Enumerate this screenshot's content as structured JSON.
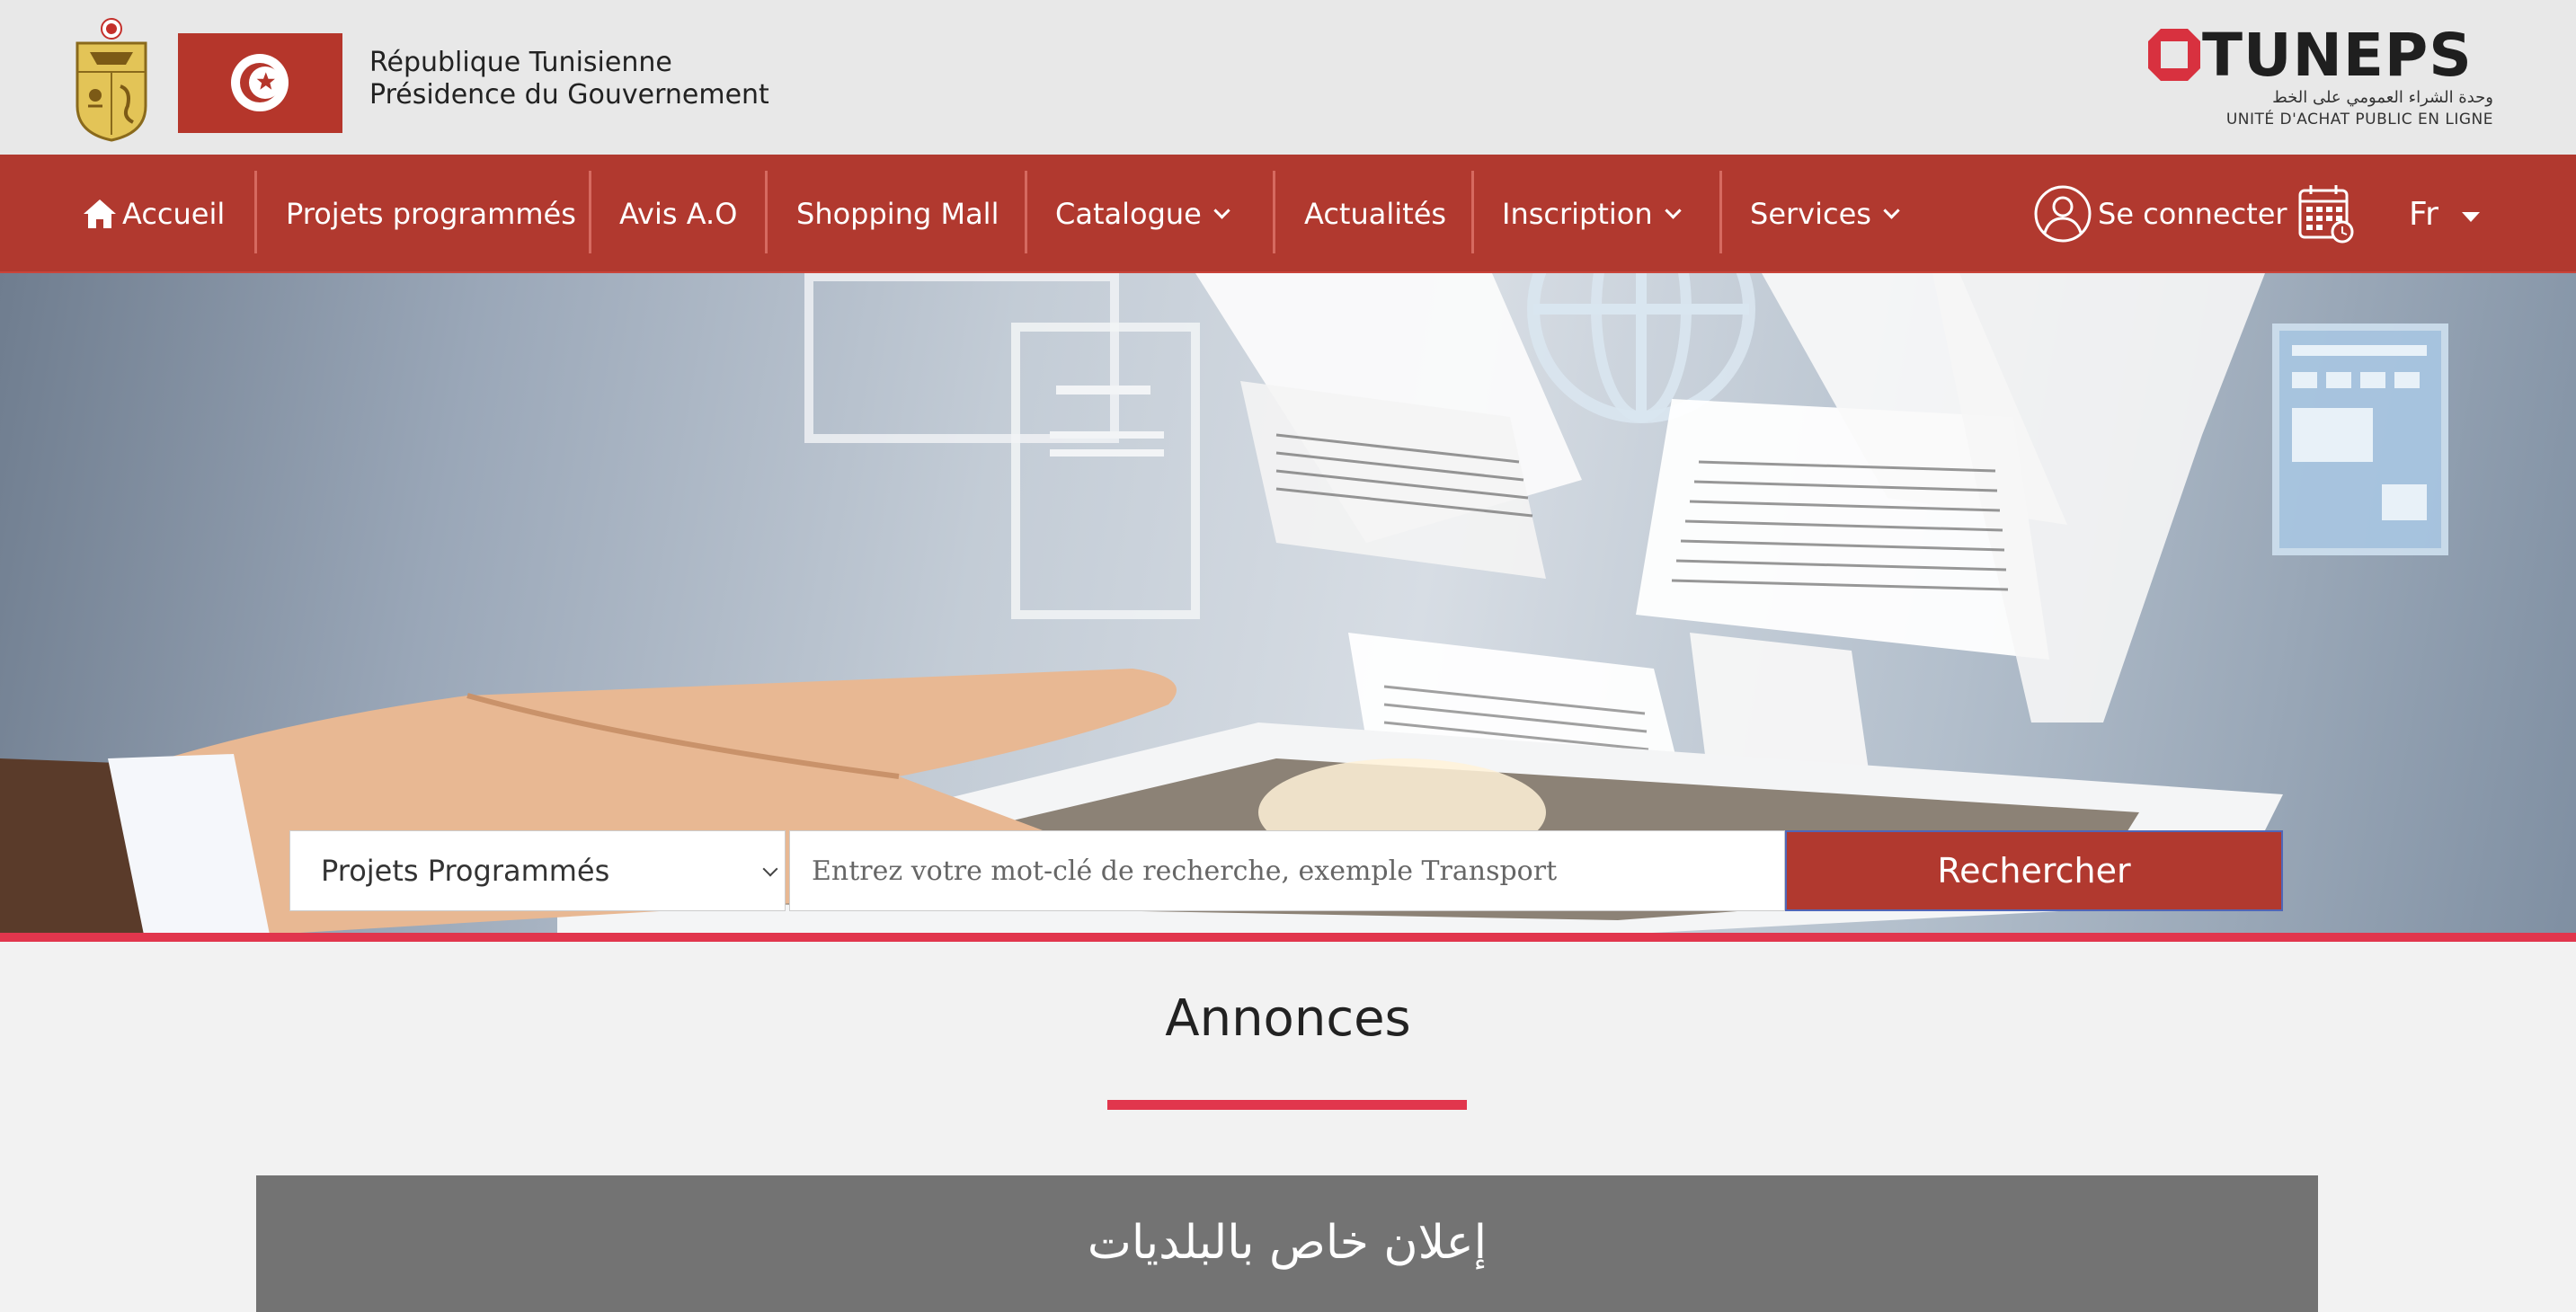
{
  "header": {
    "gov_line1": "République Tunisienne",
    "gov_line2": "Présidence du Gouvernement",
    "logo": {
      "name": "TUNEPS",
      "arabic": "وحدة الشراء العمومي على الخط",
      "subtitle": "UNITÉ D'ACHAT PUBLIC EN LIGNE"
    }
  },
  "nav": {
    "items": [
      {
        "label": "Accueil",
        "icon": "home-icon"
      },
      {
        "label": "Projets programmés"
      },
      {
        "label": "Avis A.O"
      },
      {
        "label": "Shopping Mall"
      },
      {
        "label": "Catalogue",
        "dropdown": true
      },
      {
        "label": "Actualités"
      },
      {
        "label": "Inscription",
        "dropdown": true
      },
      {
        "label": "Services",
        "dropdown": true
      }
    ],
    "login_label": "Se connecter",
    "language": "Fr"
  },
  "search": {
    "category_selected": "Projets Programmés",
    "placeholder": "Entrez votre mot-clé de recherche, exemple Transport",
    "button_label": "Rechercher"
  },
  "annonces": {
    "title": "Annonces",
    "card_text": "إعلان خاص بالبلديات"
  },
  "colors": {
    "brand_red": "#b1392f",
    "accent_pink": "#e1364d",
    "card_gray": "#737373"
  }
}
